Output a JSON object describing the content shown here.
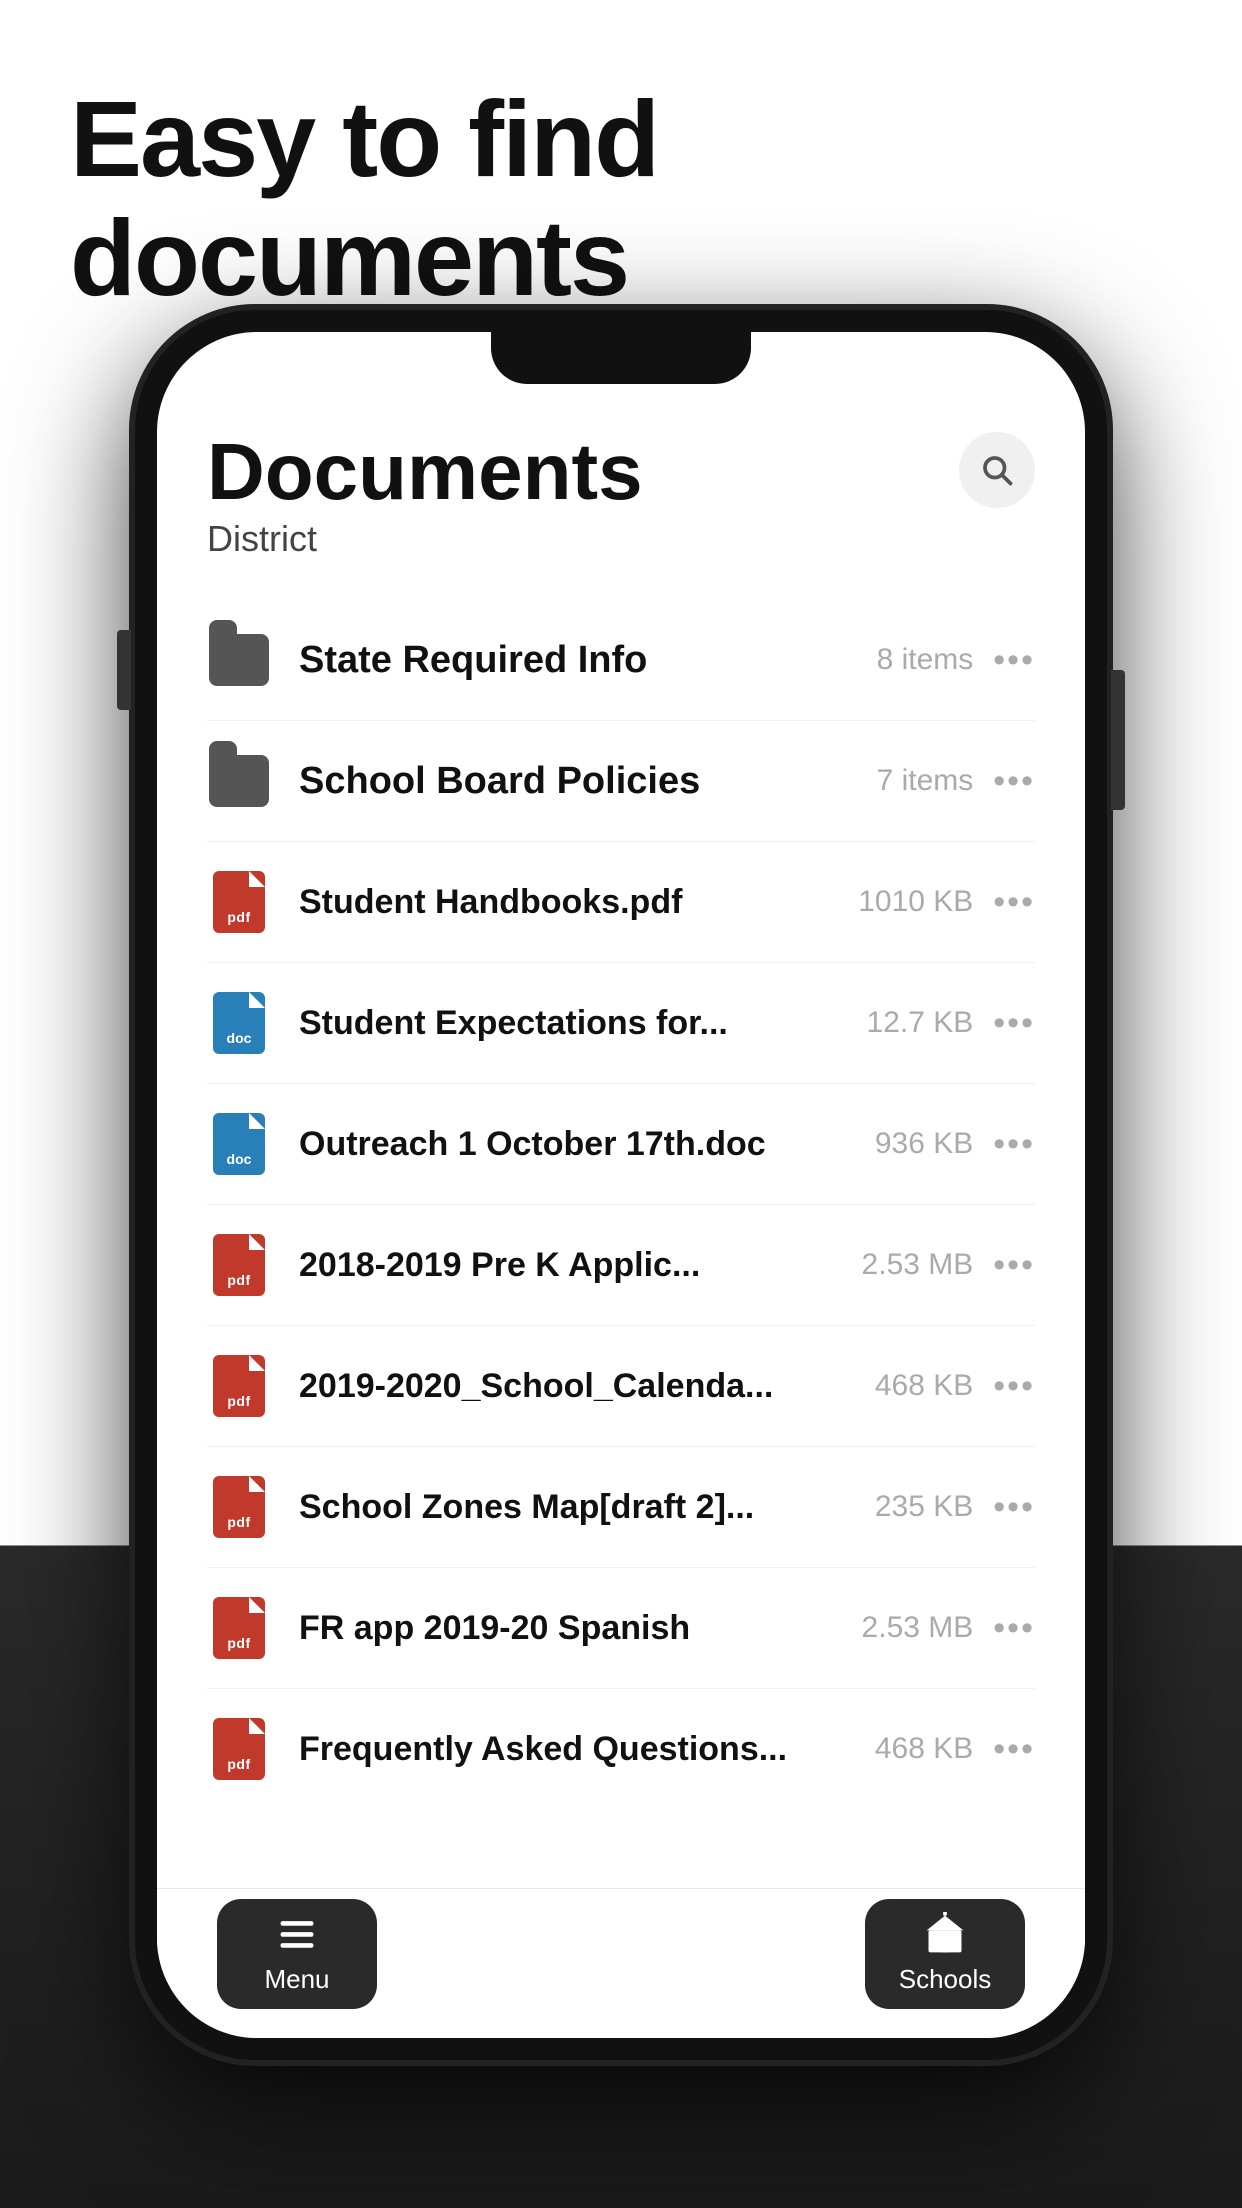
{
  "page": {
    "headline": "Easy to find documents",
    "bg_color": "#ffffff",
    "dark_color": "#1a1a1a"
  },
  "app": {
    "title": "Documents",
    "subtitle": "District",
    "search_label": "Search"
  },
  "items": [
    {
      "id": "state-required-info",
      "type": "folder",
      "name": "State Required Info",
      "meta": "8 items"
    },
    {
      "id": "school-board-policies",
      "type": "folder",
      "name": "School Board Policies",
      "meta": "7 items"
    },
    {
      "id": "student-handbooks",
      "type": "pdf",
      "name": "Student Handbooks.pdf",
      "meta": "1010 KB"
    },
    {
      "id": "student-expectations",
      "type": "doc",
      "name": "Student Expectations for...",
      "meta": "12.7 KB"
    },
    {
      "id": "outreach-october",
      "type": "doc",
      "name": "Outreach 1 October 17th.doc",
      "meta": "936 KB"
    },
    {
      "id": "pre-k-applic",
      "type": "pdf",
      "name": "2018-2019 Pre K Applic...",
      "meta": "2.53 MB"
    },
    {
      "id": "school-calendar",
      "type": "pdf",
      "name": "2019-2020_School_Calenda...",
      "meta": "468 KB"
    },
    {
      "id": "school-zones-map",
      "type": "pdf",
      "name": "School Zones Map[draft 2]...",
      "meta": "235 KB"
    },
    {
      "id": "fr-app-spanish",
      "type": "pdf",
      "name": "FR app 2019-20 Spanish",
      "meta": "2.53 MB"
    },
    {
      "id": "faq",
      "type": "pdf",
      "name": "Frequently Asked Questions...",
      "meta": "468 KB"
    }
  ],
  "tabs": [
    {
      "id": "menu",
      "label": "Menu"
    },
    {
      "id": "schools",
      "label": "Schools"
    }
  ],
  "more_dots": "•••"
}
